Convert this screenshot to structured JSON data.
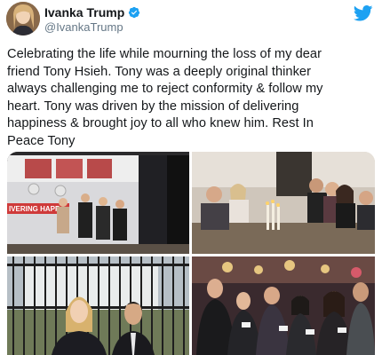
{
  "tweet": {
    "author": {
      "display_name": "Ivanka Trump",
      "handle": "@IvankaTrump",
      "verified": true,
      "avatar": "avatar-photo"
    },
    "platform_icon": "twitter-bird-icon",
    "text_lines": [
      "Celebrating the life while mourning the loss of my dear",
      "friend Tony Hsieh. Tony was a deeply original thinker",
      "always challenging me to reject conformity & follow my",
      "heart. Tony was driven by the mission of delivering",
      "happiness & brought joy to all who knew him. Rest In",
      "Peace Tony"
    ],
    "media": [
      {
        "photo": "group-in-front-of-tour-bus",
        "bus_lettering": "IVERING HAPP"
      },
      {
        "photo": "dinner-table-with-candles"
      },
      {
        "photo": "two-people-in-front-of-white-house-fence"
      },
      {
        "photo": "group-at-party-holding-cups"
      }
    ]
  },
  "colors": {
    "accent_blue": "#1da1f2",
    "text_primary": "#14171a",
    "text_secondary": "#657786"
  }
}
